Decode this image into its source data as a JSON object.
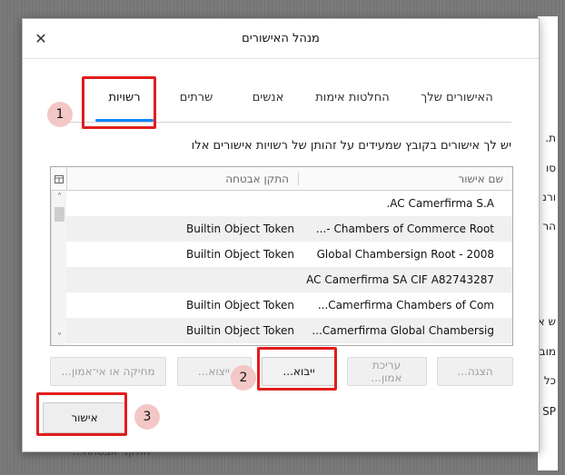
{
  "background": {
    "right_fragments": [
      "ת.",
      "סו",
      "ורנ",
      "הר",
      "ש א",
      "מוב",
      "כל",
      "SP"
    ],
    "bottom_fragment": "התקני אבטחה..."
  },
  "dialog": {
    "title": "מנהל האישורים",
    "close_glyph": "✕",
    "tabs": [
      {
        "label": "האישורים שלך",
        "selected": false
      },
      {
        "label": "החלטות אימות",
        "selected": false
      },
      {
        "label": "אנשים",
        "selected": false
      },
      {
        "label": "שרתים",
        "selected": false
      },
      {
        "label": "רשויות",
        "selected": true
      }
    ],
    "description": "יש לך אישורים בקובץ שמעידים על זהותן של רשויות אישורים אלו",
    "table": {
      "headers": {
        "name": "שם אישור",
        "token": "התקן אבטחה"
      },
      "column_picker_icon": "column-picker-icon",
      "rows": [
        {
          "name": "AC Camerfirma S.A.",
          "token": ""
        },
        {
          "name": "Chambers of Commerce Root -...",
          "token": "Builtin Object Token"
        },
        {
          "name": "Global Chambersign Root - 2008",
          "token": "Builtin Object Token"
        },
        {
          "name": "AC Camerfirma SA CIF A82743287",
          "token": ""
        },
        {
          "name": "Camerfirma Chambers of Com...",
          "token": "Builtin Object Token"
        },
        {
          "name": "Camerfirma Global Chambersig...",
          "token": "Builtin Object Token"
        }
      ],
      "scroll_up": "˄",
      "scroll_down": "˅"
    },
    "buttons": {
      "view": "הצגה...",
      "edit": "עריכת אמון...",
      "import": "ייבוא...",
      "export": "ייצוא...",
      "delete": "מחיקה או אי־אמון..."
    },
    "ok": "אישור"
  },
  "annotations": {
    "badge_1": "1",
    "badge_2": "2",
    "badge_3": "3",
    "highlight_color": "#e21d1d"
  }
}
